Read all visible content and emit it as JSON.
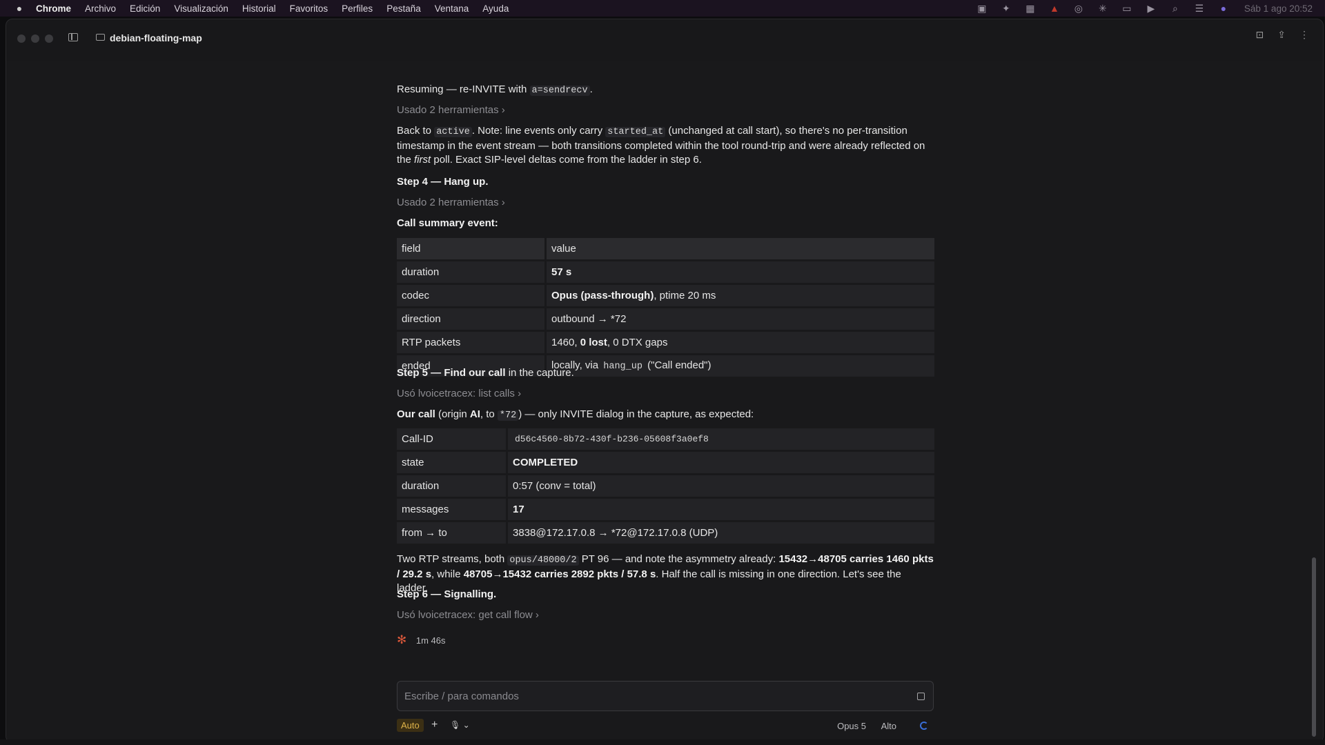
{
  "menubar": {
    "items": [
      "Chrome",
      "Archivo",
      "Edición",
      "Visualización",
      "Historial",
      "Favoritos",
      "Perfiles",
      "Pestaña",
      "Ventana",
      "Ayuda"
    ],
    "clock": "Sáb 1 ago 20:52"
  },
  "window": {
    "tab_title": "debian-floating-map"
  },
  "chat": {
    "p_resume_a": "Resuming — re-INVITE with ",
    "p_resume_code": "a=sendrecv",
    "p_resume_b": ".",
    "tools1": "Usado 2 herramientas",
    "p_back_1": "Back to ",
    "p_back_code1": "active",
    "p_back_2": ". Note: line events only carry ",
    "p_back_code2": "started_at",
    "p_back_3": " (unchanged at call start), so there's no per-transition timestamp in the event stream — both transitions completed within the tool round-trip and were already reflected on the ",
    "p_back_em": "first",
    "p_back_4": " poll. Exact SIP-level deltas come from the ladder in step 6.",
    "step4": "Step 4 — Hang up.",
    "tools2": "Usado 2 herramientas",
    "summary_heading": "Call summary event:",
    "summary_table": {
      "header": [
        "field",
        "value"
      ],
      "rows": [
        {
          "field": "duration",
          "value_bold": "57 s",
          "value_rest": ""
        },
        {
          "field": "codec",
          "value_bold": "Opus (pass-through)",
          "value_rest": ", ptime 20 ms"
        },
        {
          "field": "direction",
          "value_bold": "",
          "value_rest": "outbound → *72"
        },
        {
          "field": "RTP packets",
          "value_pre": "1460, ",
          "value_bold": "0 lost",
          "value_rest": ", 0 DTX gaps"
        },
        {
          "field": "ended",
          "value_pre": "locally, via ",
          "value_code": "hang_up",
          "value_rest": " (\"Call ended\")"
        }
      ]
    },
    "step5_bold": "Step 5 — Find our call",
    "step5_rest": " in the capture.",
    "tools3": "Usó lvoicetracex: list calls",
    "ourcall_bold": "Our call",
    "ourcall_1": " (origin ",
    "ourcall_ai": "AI",
    "ourcall_2": ", to ",
    "ourcall_code": "*72",
    "ourcall_3": ") — only INVITE dialog in the capture, as expected:",
    "call_table": {
      "rows": [
        {
          "k": "Call-ID",
          "v": "d56c4560-8b72-430f-b236-05608f3a0ef8",
          "mono": true,
          "bold": false
        },
        {
          "k": "state",
          "v": "COMPLETED",
          "mono": false,
          "bold": true
        },
        {
          "k": "duration",
          "v": "0:57 (conv = total)",
          "mono": false,
          "bold": false
        },
        {
          "k": "messages",
          "v": "17",
          "mono": false,
          "bold": true
        },
        {
          "k": "from → to",
          "v": "3838@172.17.0.8 → *72@172.17.0.8 (UDP)",
          "mono": false,
          "bold": false
        }
      ]
    },
    "rtp_1": "Two RTP streams, both ",
    "rtp_code": "opus/48000/2",
    "rtp_2": " PT 96 — and note the asymmetry already: ",
    "rtp_b1": "15432→48705 carries 1460 pkts / 29.2 s",
    "rtp_3": ", while ",
    "rtp_b2": "48705→15432 carries 2892 pkts / 57.8 s",
    "rtp_4": ". Half the call is missing in one direction. Let's see the ladder.",
    "step6": "Step 6 — Signalling.",
    "tools4": "Usó lvoicetracex: get call flow",
    "elapsed": "1m 46s"
  },
  "composer": {
    "placeholder": "Escribe / para comandos",
    "mode": "Auto",
    "model": "Opus 5",
    "effort": "Alto"
  },
  "colors": {
    "accent": "#e0b44a",
    "spinner": "#3a6fd8",
    "asterisk": "#d9573a"
  }
}
